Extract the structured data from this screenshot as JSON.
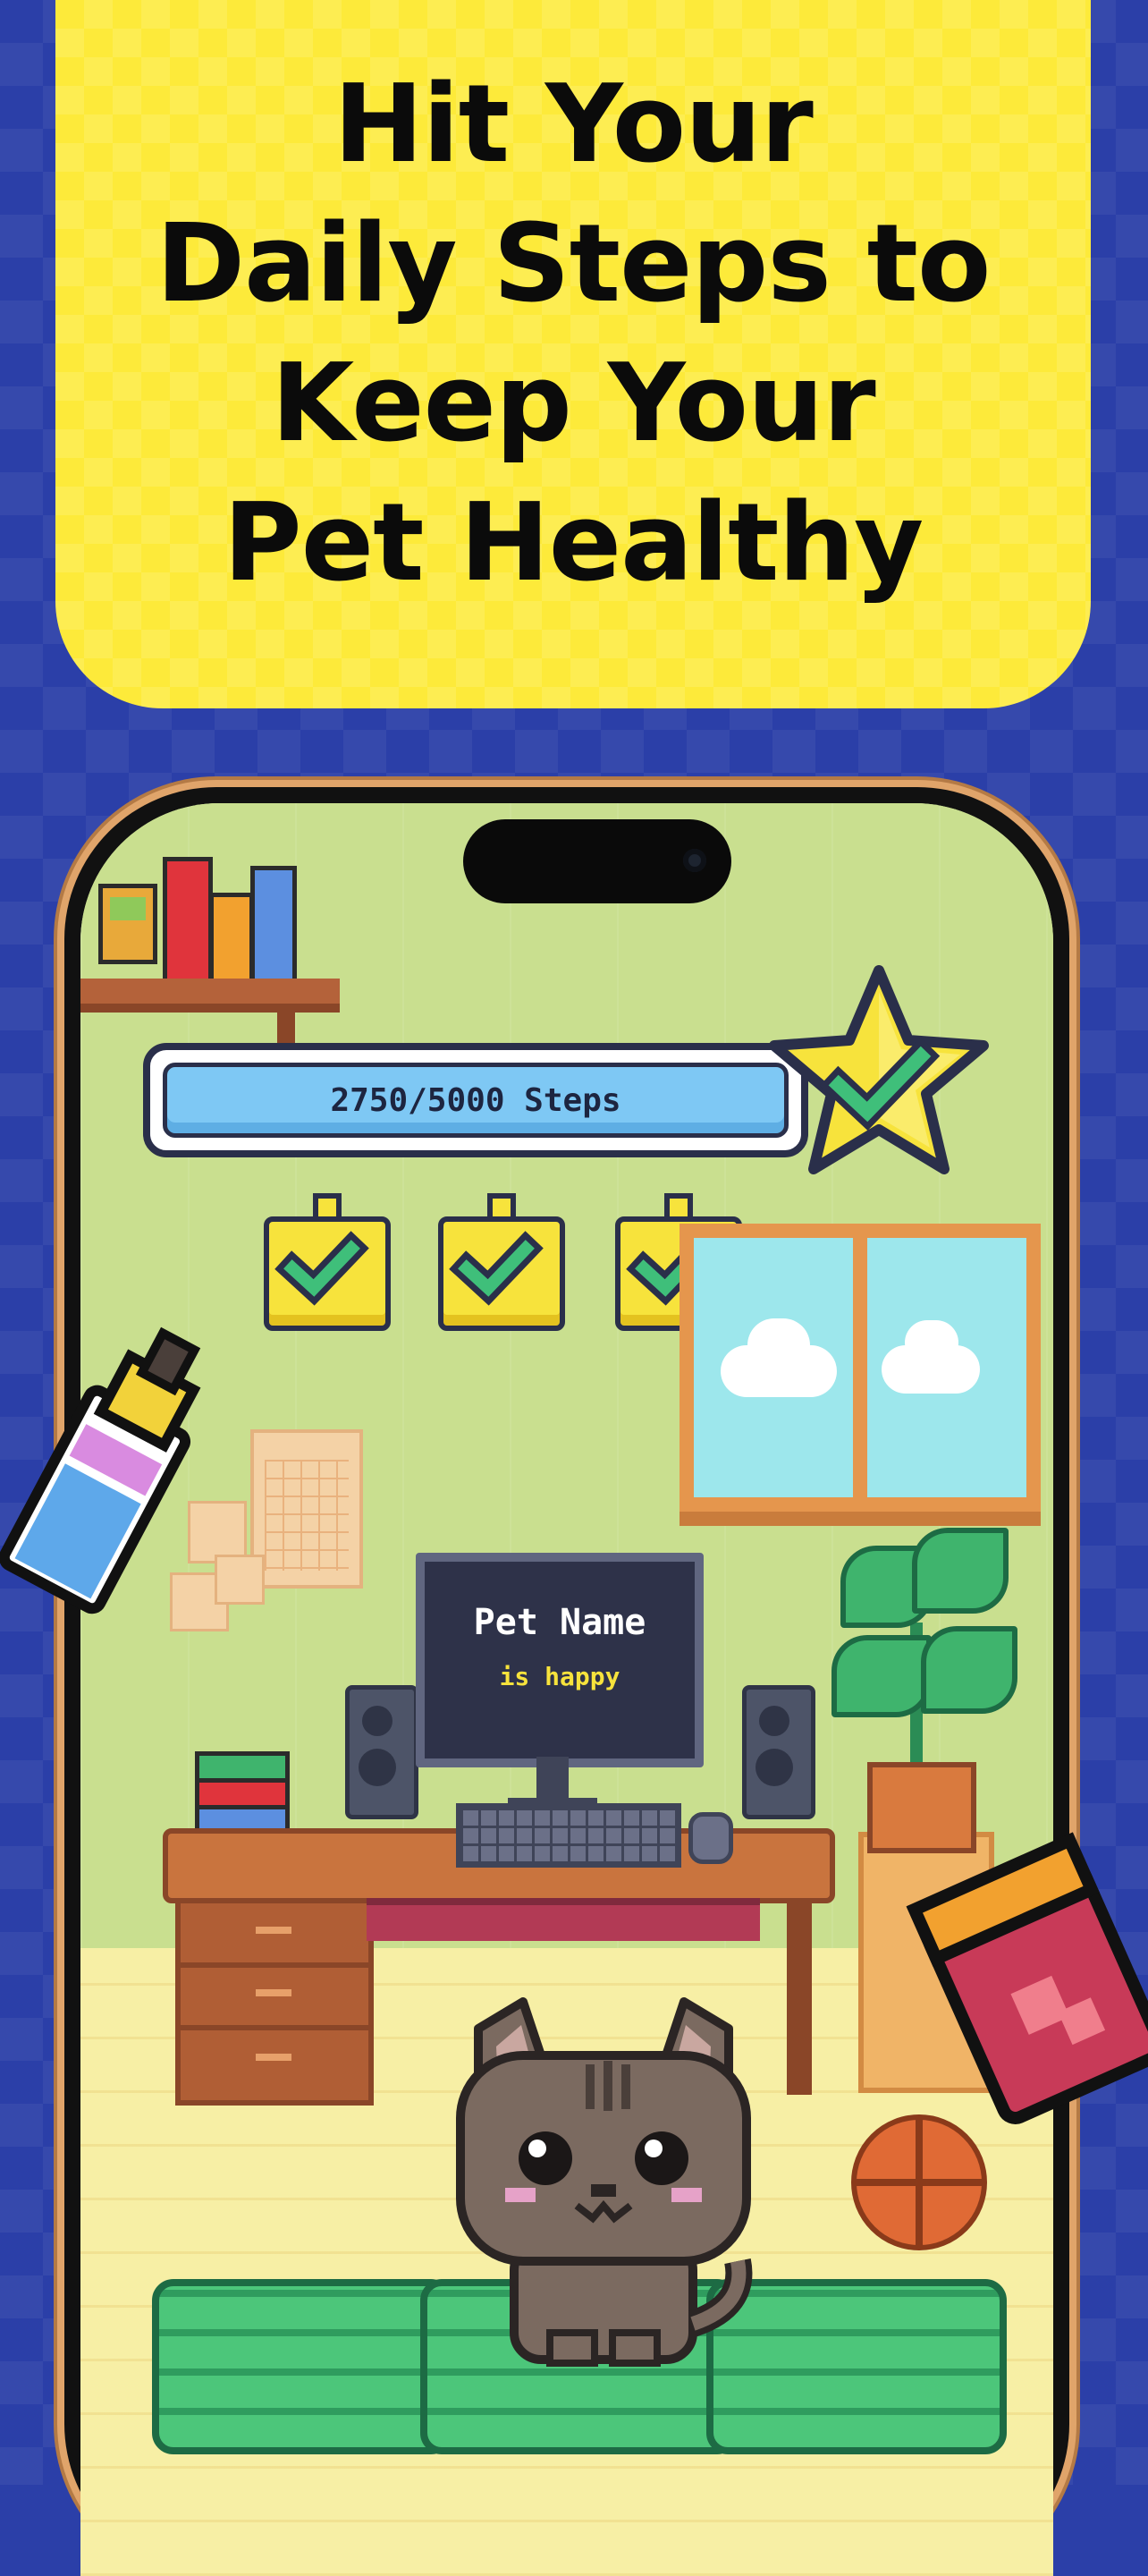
{
  "headline": {
    "lines": [
      "Hit Your",
      "Daily Steps to",
      "Keep Your",
      "Pet Healthy"
    ]
  },
  "game": {
    "steps_label": "2750/5000 Steps",
    "steps_current": 2750,
    "steps_goal": 5000,
    "goal_star_icon": "star-check-icon",
    "tasks": [
      {
        "icon": "check-icon",
        "done": true
      },
      {
        "icon": "check-icon",
        "done": true
      },
      {
        "icon": "check-icon",
        "done": true
      }
    ],
    "monitor": {
      "pet_name": "Pet Name",
      "status": "is happy"
    }
  },
  "colors": {
    "background": "#2b3fa8",
    "banner": "#fdea3a",
    "progress_fill": "#7ec8f4",
    "check_green": "#3fbf7a",
    "star_yellow": "#f7e33c"
  }
}
